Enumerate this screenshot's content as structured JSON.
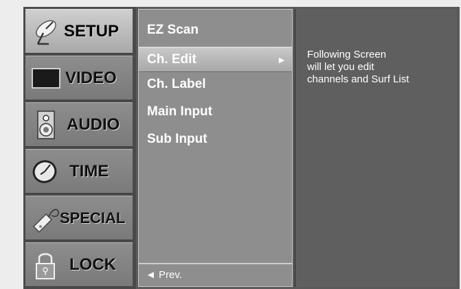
{
  "categories": [
    {
      "label": "SETUP",
      "icon": "satellite-dish-icon",
      "active": true
    },
    {
      "label": "VIDEO",
      "icon": "monitor-icon",
      "active": false
    },
    {
      "label": "AUDIO",
      "icon": "speaker-icon",
      "active": false
    },
    {
      "label": "TIME",
      "icon": "clock-icon",
      "active": false
    },
    {
      "label": "SPECIAL",
      "icon": "tag-key-icon",
      "active": false
    },
    {
      "label": "LOCK",
      "icon": "padlock-icon",
      "active": false
    }
  ],
  "menu": {
    "items": [
      {
        "label": "EZ Scan",
        "selected": false
      },
      {
        "label": "Ch. Edit",
        "selected": true
      },
      {
        "label": "Ch. Label",
        "selected": false
      },
      {
        "label": "Main Input",
        "selected": false
      },
      {
        "label": "Sub Input",
        "selected": false
      }
    ],
    "selected_arrow": "►",
    "prev_label": "◄ Prev."
  },
  "info": {
    "lines": [
      "Following Screen",
      "will let you edit",
      "channels and Surf List"
    ]
  }
}
